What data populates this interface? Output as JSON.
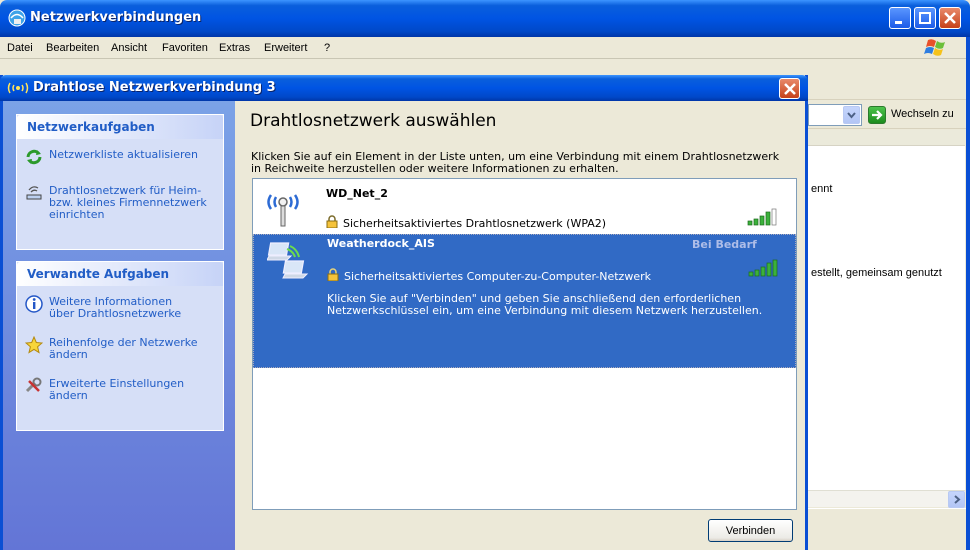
{
  "background_window": {
    "title": "Netzwerkverbindungen",
    "menu": [
      "Datei",
      "Bearbeiten",
      "Ansicht",
      "Favoriten",
      "Extras",
      "Erweitert",
      "?"
    ],
    "go_label": "Wechseln zu",
    "content_lines": [
      "ennt",
      "estellt, gemeinsam genutzt"
    ]
  },
  "dialog": {
    "title": "Drahtlose Netzwerkverbindung 3",
    "heading": "Drahtlosnetzwerk auswählen",
    "description": "Klicken Sie auf ein Element in der Liste unten, um eine Verbindung mit einem Drahtlosnetzwerk in Reichweite herzustellen oder weitere Informationen zu erhalten.",
    "connect_label": "Verbinden",
    "task_panels": [
      {
        "title": "Netzwerkaufgaben",
        "items": [
          {
            "icon": "refresh-icon",
            "label": "Netzwerkliste aktualisieren"
          },
          {
            "icon": "wireless-setup-icon",
            "label": "Drahtlosnetzwerk für Heim- bzw. kleines Firmennetzwerk einrichten"
          }
        ]
      },
      {
        "title": "Verwandte Aufgaben",
        "items": [
          {
            "icon": "info-icon",
            "label": "Weitere Informationen über Drahtlosnetzwerke"
          },
          {
            "icon": "star-icon",
            "label": "Reihenfolge der Netzwerke ändern"
          },
          {
            "icon": "tools-icon",
            "label": "Erweiterte Einstellungen ändern"
          }
        ]
      }
    ],
    "networks": [
      {
        "name": "WD_Net_2",
        "security": "Sicherheitsaktiviertes Drahtlosnetzwerk (WPA2)",
        "icon": "access-point-icon",
        "signal_bars": 4,
        "selected": false
      },
      {
        "name": "Weatherdock_AIS",
        "state": "Bei Bedarf",
        "security": "Sicherheitsaktiviertes Computer-zu-Computer-Netzwerk",
        "details": "Klicken Sie auf \"Verbinden\" und geben Sie anschließend den erforderlichen Netzwerkschlüssel ein, um eine Verbindung mit diesem Netzwerk herzustellen.",
        "icon": "adhoc-computer-icon",
        "signal_bars": 5,
        "selected": true
      }
    ]
  },
  "colors": {
    "titlebar_blue": "#0054e3",
    "selection_blue": "#316ac5",
    "task_link": "#215dc6",
    "signal_green": "#3bb13b"
  }
}
